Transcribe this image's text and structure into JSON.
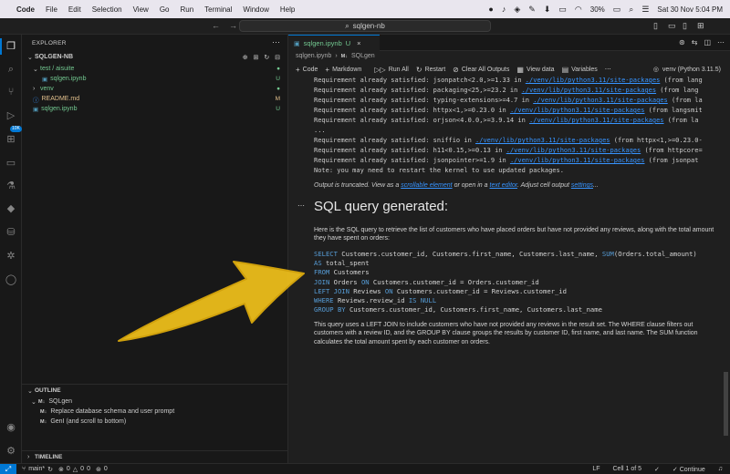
{
  "menubar": {
    "app": "Code",
    "items": [
      "File",
      "Edit",
      "Selection",
      "View",
      "Go",
      "Run",
      "Terminal",
      "Window",
      "Help"
    ],
    "battery": "30%",
    "datetime": "Sat 30 Nov  5:04 PM"
  },
  "titlebar": {
    "search": "sqlgen-nb"
  },
  "explorer": {
    "header": "EXPLORER",
    "root": "SQLGEN-NB",
    "tree": [
      {
        "label": "test / aisuite",
        "status": "",
        "kind": "folder"
      },
      {
        "label": "sqlgen.ipynb",
        "status": "U",
        "kind": "notebook"
      },
      {
        "label": "venv",
        "status": "",
        "kind": "folder"
      },
      {
        "label": "README.md",
        "status": "M",
        "kind": "info"
      },
      {
        "label": "sqlgen.ipynb",
        "status": "U",
        "kind": "notebook"
      }
    ]
  },
  "outline": {
    "header": "OUTLINE",
    "root_badge": "M↓",
    "root": "SQLgen",
    "items": [
      {
        "badge": "M↓",
        "label": "Replace database schema and user prompt"
      },
      {
        "badge": "M↓",
        "label": "GenI (and scroll to bottom)"
      }
    ]
  },
  "timeline": {
    "header": "TIMELINE"
  },
  "editor": {
    "tab": {
      "label": "sqlgen.ipynb",
      "status": "U"
    },
    "breadcrumb": {
      "file": "sqlgen.ipynb",
      "badge": "M↓",
      "section": "SQLgen"
    },
    "toolbar": {
      "code": "Code",
      "markdown": "Markdown",
      "run_all": "Run All",
      "restart": "Restart",
      "clear": "Clear All Outputs",
      "variables_view": "View data",
      "variables": "Variables",
      "kernel": "venv (Python 3.11.5)"
    },
    "output_lines": [
      {
        "pre": "Requirement already satisfied: jsonpatch<2.0,>=1.33 in ",
        "link": "./venv/lib/python3.11/site-packages",
        "post": " (from lang"
      },
      {
        "pre": "Requirement already satisfied: packaging<25,>=23.2 in ",
        "link": "./venv/lib/python3.11/site-packages",
        "post": " (from lang"
      },
      {
        "pre": "Requirement already satisfied: typing-extensions>=4.7 in ",
        "link": "./venv/lib/python3.11/site-packages",
        "post": " (from la"
      },
      {
        "pre": "Requirement already satisfied: httpx<1,>=0.23.0 in ",
        "link": "./venv/lib/python3.11/site-packages",
        "post": " (from langsmit"
      },
      {
        "pre": "Requirement already satisfied: orjson<4.0.0,>=3.9.14 in ",
        "link": "./venv/lib/python3.11/site-packages",
        "post": " (from la"
      },
      {
        "pre": "...",
        "link": "",
        "post": ""
      },
      {
        "pre": "Requirement already satisfied: sniffio in ",
        "link": "./venv/lib/python3.11/site-packages",
        "post": " (from httpx<1,>=0.23.0-"
      },
      {
        "pre": "Requirement already satisfied: h11<0.15,>=0.13 in ",
        "link": "./venv/lib/python3.11/site-packages",
        "post": " (from httpcore="
      },
      {
        "pre": "Requirement already satisfied: jsonpointer>=1.9 in ",
        "link": "./venv/lib/python3.11/site-packages",
        "post": " (from jsonpat"
      },
      {
        "pre": "Note: you may need to restart the kernel to use updated packages.",
        "link": "",
        "post": ""
      }
    ],
    "truncated": {
      "pre": "Output is truncated. View as a ",
      "link1": "scrollable element",
      "mid": " or open in a ",
      "link2": "text editor",
      "mid2": ". Adjust cell output ",
      "link3": "settings",
      "post": "..."
    },
    "md_title": "SQL query generated:",
    "md_intro": "Here is the SQL query to retrieve the list of customers who have placed orders but have not provided any reviews, along with the total amount they have spent on orders:",
    "sql_lines": [
      [
        [
          "kw",
          "SELECT"
        ],
        [
          "t",
          " Customers.customer_id, Customers.first_name, Customers.last_name, "
        ],
        [
          "kw",
          "SUM"
        ],
        [
          "t",
          "(Orders.total_amount)"
        ]
      ],
      [
        [
          "kw",
          "AS"
        ],
        [
          "t",
          " total_spent"
        ]
      ],
      [
        [
          "kw",
          "FROM"
        ],
        [
          "t",
          " Customers"
        ]
      ],
      [
        [
          "kw",
          "JOIN"
        ],
        [
          "t",
          " Orders "
        ],
        [
          "kw",
          "ON"
        ],
        [
          "t",
          " Customers.customer_id = Orders.customer_id"
        ]
      ],
      [
        [
          "kw",
          "LEFT JOIN"
        ],
        [
          "t",
          " Reviews "
        ],
        [
          "kw",
          "ON"
        ],
        [
          "t",
          " Customers.customer_id = Reviews.customer_id"
        ]
      ],
      [
        [
          "kw",
          "WHERE"
        ],
        [
          "t",
          " Reviews.review_id "
        ],
        [
          "kw",
          "IS NULL"
        ]
      ],
      [
        [
          "kw",
          "GROUP BY"
        ],
        [
          "t",
          " Customers.customer_id, Customers.first_name, Customers.last_name"
        ]
      ]
    ],
    "md_explain": "This query uses a LEFT JOIN to include customers who have not provided any reviews in the result set. The WHERE clause filters out customers with a review ID, and the GROUP BY clause groups the results by customer ID, first name, and last name. The SUM function calculates the total amount spent by each customer on orders."
  },
  "statusbar": {
    "branch": "main*",
    "problems": "0",
    "warnings": "0",
    "info": "0",
    "ports": "0",
    "eol": "LF",
    "cell": "Cell 1 of 5",
    "continue": "Continue"
  },
  "colors": {
    "accent": "#0078d4",
    "untracked": "#73c991",
    "modified": "#e2c08d",
    "link": "#3794ff",
    "annotation": "#f2c21b"
  }
}
